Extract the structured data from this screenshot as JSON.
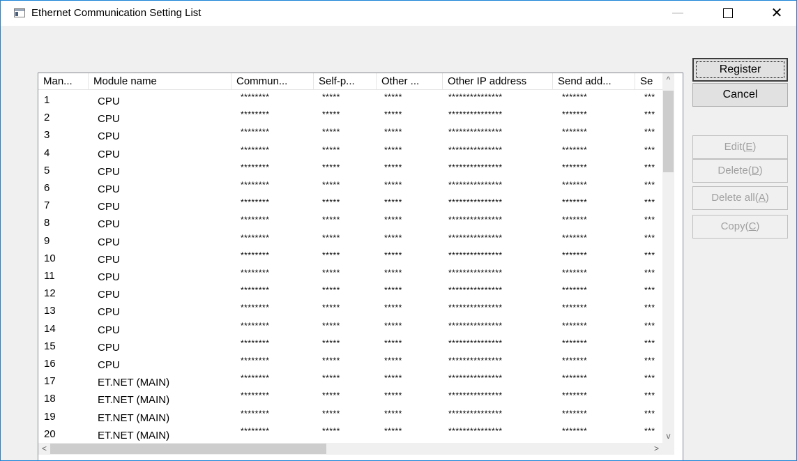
{
  "window": {
    "title": "Ethernet Communication Setting List"
  },
  "titlebar_buttons": {
    "minimize": "—",
    "maximize": "□",
    "close": "✕"
  },
  "columns": [
    "Man...",
    "Module name",
    "Commun...",
    "Self-p...",
    "Other ...",
    "Other IP address",
    "Send add...",
    "Se"
  ],
  "rows": [
    {
      "num": "1",
      "module": "CPU",
      "comm": "********",
      "self": "*****",
      "other": "*****",
      "ip": "***************",
      "send": "*******",
      "se": "***"
    },
    {
      "num": "2",
      "module": "CPU",
      "comm": "********",
      "self": "*****",
      "other": "*****",
      "ip": "***************",
      "send": "*******",
      "se": "***"
    },
    {
      "num": "3",
      "module": "CPU",
      "comm": "********",
      "self": "*****",
      "other": "*****",
      "ip": "***************",
      "send": "*******",
      "se": "***"
    },
    {
      "num": "4",
      "module": "CPU",
      "comm": "********",
      "self": "*****",
      "other": "*****",
      "ip": "***************",
      "send": "*******",
      "se": "***"
    },
    {
      "num": "5",
      "module": "CPU",
      "comm": "********",
      "self": "*****",
      "other": "*****",
      "ip": "***************",
      "send": "*******",
      "se": "***"
    },
    {
      "num": "6",
      "module": "CPU",
      "comm": "********",
      "self": "*****",
      "other": "*****",
      "ip": "***************",
      "send": "*******",
      "se": "***"
    },
    {
      "num": "7",
      "module": "CPU",
      "comm": "********",
      "self": "*****",
      "other": "*****",
      "ip": "***************",
      "send": "*******",
      "se": "***"
    },
    {
      "num": "8",
      "module": "CPU",
      "comm": "********",
      "self": "*****",
      "other": "*****",
      "ip": "***************",
      "send": "*******",
      "se": "***"
    },
    {
      "num": "9",
      "module": "CPU",
      "comm": "********",
      "self": "*****",
      "other": "*****",
      "ip": "***************",
      "send": "*******",
      "se": "***"
    },
    {
      "num": "10",
      "module": "CPU",
      "comm": "********",
      "self": "*****",
      "other": "*****",
      "ip": "***************",
      "send": "*******",
      "se": "***"
    },
    {
      "num": "11",
      "module": "CPU",
      "comm": "********",
      "self": "*****",
      "other": "*****",
      "ip": "***************",
      "send": "*******",
      "se": "***"
    },
    {
      "num": "12",
      "module": "CPU",
      "comm": "********",
      "self": "*****",
      "other": "*****",
      "ip": "***************",
      "send": "*******",
      "se": "***"
    },
    {
      "num": "13",
      "module": "CPU",
      "comm": "********",
      "self": "*****",
      "other": "*****",
      "ip": "***************",
      "send": "*******",
      "se": "***"
    },
    {
      "num": "14",
      "module": "CPU",
      "comm": "********",
      "self": "*****",
      "other": "*****",
      "ip": "***************",
      "send": "*******",
      "se": "***"
    },
    {
      "num": "15",
      "module": "CPU",
      "comm": "********",
      "self": "*****",
      "other": "*****",
      "ip": "***************",
      "send": "*******",
      "se": "***"
    },
    {
      "num": "16",
      "module": "CPU",
      "comm": "********",
      "self": "*****",
      "other": "*****",
      "ip": "***************",
      "send": "*******",
      "se": "***"
    },
    {
      "num": "17",
      "module": "ET.NET  (MAIN)",
      "comm": "********",
      "self": "*****",
      "other": "*****",
      "ip": "***************",
      "send": "*******",
      "se": "***"
    },
    {
      "num": "18",
      "module": "ET.NET  (MAIN)",
      "comm": "********",
      "self": "*****",
      "other": "*****",
      "ip": "***************",
      "send": "*******",
      "se": "***"
    },
    {
      "num": "19",
      "module": "ET.NET  (MAIN)",
      "comm": "********",
      "self": "*****",
      "other": "*****",
      "ip": "***************",
      "send": "*******",
      "se": "***"
    },
    {
      "num": "20",
      "module": "ET.NET  (MAIN)",
      "comm": "********",
      "self": "*****",
      "other": "*****",
      "ip": "***************",
      "send": "*******",
      "se": "***"
    }
  ],
  "scroll_arrows": {
    "up": "^",
    "down": "v",
    "left": "<",
    "right": ">"
  },
  "buttons": {
    "register": "Register",
    "cancel": "Cancel",
    "edit": {
      "text": "Edit(",
      "key": "E",
      "close": ")"
    },
    "delete": {
      "text": "Delete(",
      "key": "D",
      "close": ")"
    },
    "delete_all": {
      "text": "Delete all(",
      "key": "A",
      "close": ")"
    },
    "copy": {
      "text": "Copy(",
      "key": "C",
      "close": ")"
    }
  },
  "icons": {
    "app": "window-icon"
  },
  "colors": {
    "window_border": "#1883d7",
    "disabled_text": "#a0a0a0"
  }
}
